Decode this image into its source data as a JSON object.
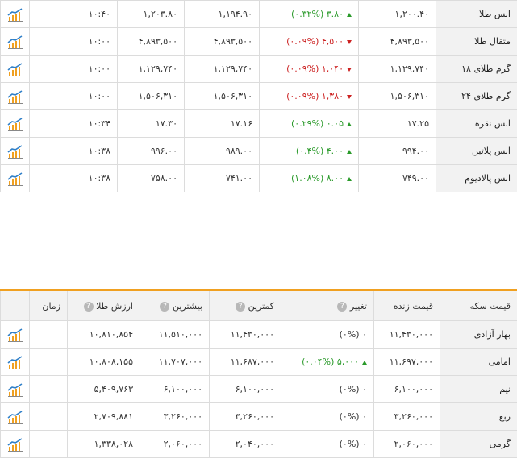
{
  "top_table": {
    "rows": [
      {
        "name": "انس طلا",
        "price": "۱,۲۰۰.۴۰",
        "change": "۳.۸۰ (۰.۳۲%)",
        "dir": "up",
        "low": "۱,۱۹۴.۹۰",
        "high": "۱,۲۰۳.۸۰",
        "time": "۱۰:۴۰"
      },
      {
        "name": "مثقال طلا",
        "price": "۴,۸۹۳,۵۰۰",
        "change": "۴,۵۰۰ (۰.۰۹%)",
        "dir": "down",
        "low": "۴,۸۹۳,۵۰۰",
        "high": "۴,۸۹۳,۵۰۰",
        "time": "۱۰:۰۰"
      },
      {
        "name": "گرم طلای ۱۸",
        "price": "۱,۱۲۹,۷۴۰",
        "change": "۱,۰۴۰ (۰.۰۹%)",
        "dir": "down",
        "low": "۱,۱۲۹,۷۴۰",
        "high": "۱,۱۲۹,۷۴۰",
        "time": "۱۰:۰۰"
      },
      {
        "name": "گرم طلای ۲۴",
        "price": "۱,۵۰۶,۳۱۰",
        "change": "۱,۳۸۰ (۰.۰۹%)",
        "dir": "down",
        "low": "۱,۵۰۶,۳۱۰",
        "high": "۱,۵۰۶,۳۱۰",
        "time": "۱۰:۰۰"
      },
      {
        "name": "انس نقره",
        "price": "۱۷.۲۵",
        "change": "۰.۰۵ (۰.۲۹%)",
        "dir": "up",
        "low": "۱۷.۱۶",
        "high": "۱۷.۳۰",
        "time": "۱۰:۳۴"
      },
      {
        "name": "انس پلاتین",
        "price": "۹۹۴.۰۰",
        "change": "۴.۰۰ (۰.۴%)",
        "dir": "up",
        "low": "۹۸۹.۰۰",
        "high": "۹۹۶.۰۰",
        "time": "۱۰:۳۸"
      },
      {
        "name": "انس پالادیوم",
        "price": "۷۴۹.۰۰",
        "change": "۸.۰۰ (۱.۰۸%)",
        "dir": "up",
        "low": "۷۴۱.۰۰",
        "high": "۷۵۸.۰۰",
        "time": "۱۰:۳۸"
      }
    ]
  },
  "coin_table": {
    "headers": {
      "name": "قیمت سکه",
      "price": "قیمت زنده",
      "change": "تغییر",
      "low": "کمترین",
      "high": "بیشترین",
      "gold_value": "ارزش طلا",
      "time": "زمان",
      "help_icon": "?"
    },
    "rows": [
      {
        "name": "بهار آزادی",
        "price": "۱۱,۴۳۰,۰۰۰",
        "change": "۰ (۰%)",
        "dir": "neutral",
        "low": "۱۱,۴۳۰,۰۰۰",
        "high": "۱۱,۵۱۰,۰۰۰",
        "gold_value": "۱۰,۸۱۰,۸۵۴"
      },
      {
        "name": "امامی",
        "price": "۱۱,۶۹۷,۰۰۰",
        "change": "۵,۰۰۰ (۰.۰۴%)",
        "dir": "up",
        "low": "۱۱,۶۸۷,۰۰۰",
        "high": "۱۱,۷۰۷,۰۰۰",
        "gold_value": "۱۰,۸۰۸,۱۵۵"
      },
      {
        "name": "نیم",
        "price": "۶,۱۰۰,۰۰۰",
        "change": "۰ (۰%)",
        "dir": "neutral",
        "low": "۶,۱۰۰,۰۰۰",
        "high": "۶,۱۰۰,۰۰۰",
        "gold_value": "۵,۴۰۹,۷۶۳"
      },
      {
        "name": "ربع",
        "price": "۳,۲۶۰,۰۰۰",
        "change": "۰ (۰%)",
        "dir": "neutral",
        "low": "۳,۲۶۰,۰۰۰",
        "high": "۳,۲۶۰,۰۰۰",
        "gold_value": "۲,۷۰۹,۸۸۱"
      },
      {
        "name": "گرمی",
        "price": "۲,۰۶۰,۰۰۰",
        "change": "۰ (۰%)",
        "dir": "neutral",
        "low": "۲,۰۴۰,۰۰۰",
        "high": "۲,۰۶۰,۰۰۰",
        "gold_value": "۱,۳۳۸,۰۲۸"
      }
    ]
  },
  "colors": {
    "up": "#2a9a2a",
    "down": "#cc2222",
    "accent": "#f0a020"
  },
  "icons": {
    "row_chart": "chart-trend-icon"
  }
}
